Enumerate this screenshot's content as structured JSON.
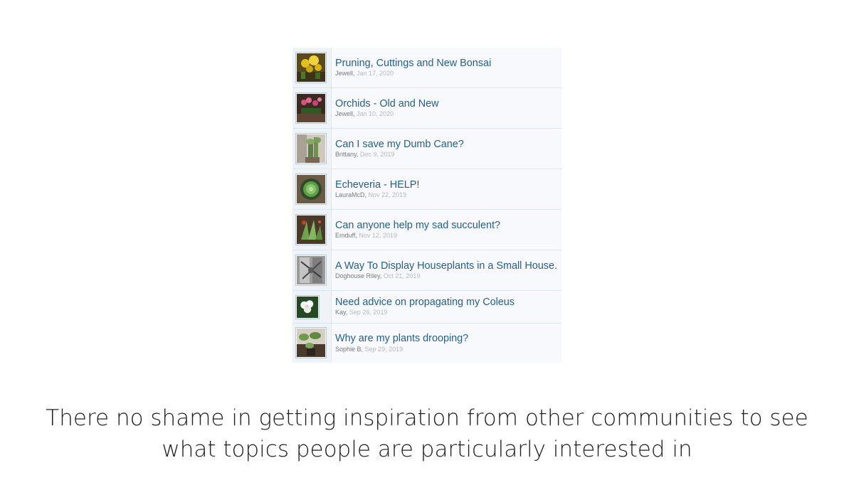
{
  "threads": [
    {
      "title": "Pruning, Cuttings and New Bonsai",
      "author": "Jewell",
      "date": "Jan 17, 2020",
      "thumbnail_icon": "yellow-flowers-photo"
    },
    {
      "title": "Orchids - Old and New",
      "author": "Jewell",
      "date": "Jan 10, 2020",
      "thumbnail_icon": "pink-orchids-photo"
    },
    {
      "title": "Can I save my Dumb Cane?",
      "author": "Brittany",
      "date": "Dec 9, 2019",
      "thumbnail_icon": "dumb-cane-photo"
    },
    {
      "title": "Echeveria - HELP!",
      "author": "LauraMcD",
      "date": "Nov 22, 2019",
      "thumbnail_icon": "echeveria-photo"
    },
    {
      "title": "Can anyone help my sad succulent?",
      "author": "Emduff",
      "date": "Nov 12, 2019",
      "thumbnail_icon": "succulent-photo"
    },
    {
      "title": "A Way To Display Houseplants in a Small House.",
      "author": "Doghouse Riley",
      "date": "Oct 21, 2019",
      "thumbnail_icon": "houseplant-display-photo"
    },
    {
      "title": "Need advice on propagating my Coleus",
      "author": "Kay",
      "date": "Sep 26, 2019",
      "thumbnail_icon": "white-flower-photo"
    },
    {
      "title": "Why are my plants drooping?",
      "author": "Sophie B",
      "date": "Sep 29, 2019",
      "thumbnail_icon": "drooping-plants-photo"
    }
  ],
  "caption": {
    "line1": "There no shame in getting inspiration from other communities to see",
    "line2": "what topics people are particularly interested in"
  }
}
